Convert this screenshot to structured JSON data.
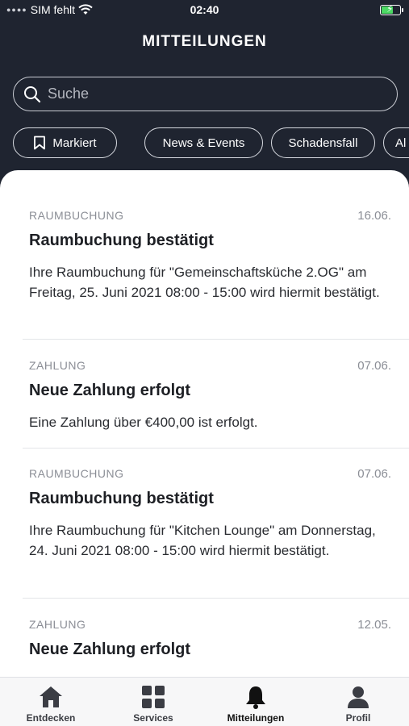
{
  "status_bar": {
    "carrier": "SIM fehlt",
    "time": "02:40"
  },
  "header": {
    "title": "MITTEILUNGEN"
  },
  "search": {
    "placeholder": "Suche"
  },
  "filters": [
    {
      "label": "Markiert",
      "icon": "bookmark-icon"
    },
    {
      "label": "News & Events"
    },
    {
      "label": "Schadensfall"
    },
    {
      "label": "Al"
    }
  ],
  "messages": [
    {
      "category": "RAUMBUCHUNG",
      "date": "16.06.",
      "title": "Raumbuchung bestätigt",
      "body": "Ihre Raumbuchung für \"Gemeinschaftsküche 2.OG\" am Freitag, 25. Juni 2021 08:00 - 15:00 wird hiermit bestätigt."
    },
    {
      "category": "ZAHLUNG",
      "date": "07.06.",
      "title": "Neue Zahlung erfolgt",
      "body": "Eine Zahlung über €400,00 ist erfolgt."
    },
    {
      "category": "RAUMBUCHUNG",
      "date": "07.06.",
      "title": "Raumbuchung bestätigt",
      "body": "Ihre Raumbuchung für \"Kitchen Lounge\" am Donnerstag, 24. Juni 2021 08:00 - 15:00 wird hiermit bestätigt."
    },
    {
      "category": "ZAHLUNG",
      "date": "12.05.",
      "title": "Neue Zahlung erfolgt",
      "body": ""
    }
  ],
  "tabs": [
    {
      "label": "Entdecken",
      "icon": "home-icon"
    },
    {
      "label": "Services",
      "icon": "grid-icon"
    },
    {
      "label": "Mitteilungen",
      "icon": "bell-icon",
      "active": true
    },
    {
      "label": "Profil",
      "icon": "person-icon"
    }
  ],
  "colors": {
    "header_bg": "#1f2430",
    "battery": "#4cd964"
  }
}
